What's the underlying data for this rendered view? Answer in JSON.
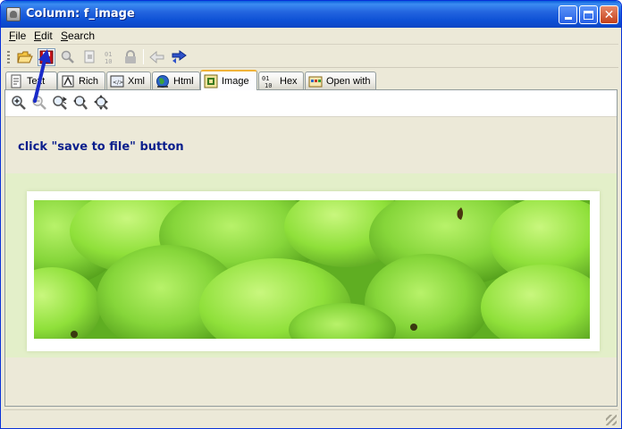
{
  "window": {
    "title": "Column: f_image"
  },
  "menu": {
    "items": [
      {
        "label": "File",
        "underline": "F",
        "rest": "ile"
      },
      {
        "label": "Edit",
        "underline": "E",
        "rest": "dit"
      },
      {
        "label": "Search",
        "underline": "S",
        "rest": "earch"
      }
    ]
  },
  "toolbar": {
    "icons": [
      "open-folder-icon",
      "save-to-file-icon",
      "find-icon",
      "copy-icon",
      "binary-icon",
      "lock-icon",
      "back-arrow-icon",
      "forward-arrow-icon"
    ]
  },
  "tabs": [
    {
      "label": "Text",
      "icon": "text-doc-icon"
    },
    {
      "label": "Rich",
      "icon": "rich-text-icon"
    },
    {
      "label": "Xml",
      "icon": "xml-icon"
    },
    {
      "label": "Html",
      "icon": "html-globe-icon"
    },
    {
      "label": "Image",
      "icon": "image-icon"
    },
    {
      "label": "Hex",
      "icon": "hex-icon"
    },
    {
      "label": "Open with",
      "icon": "open-with-icon"
    }
  ],
  "active_tab": "Image",
  "zoom_toolbar": {
    "icons": [
      "zoom-in-icon",
      "zoom-out-icon",
      "zoom-fit-icon",
      "zoom-width-icon",
      "zoom-actual-icon"
    ]
  },
  "annotation": {
    "text": "click \"save to file\" button",
    "color": "#0a1e8c"
  },
  "colors": {
    "titlebar": "#0c4fd4",
    "image_bg": "#e3efc9",
    "pear_green": "#8fe03a"
  }
}
